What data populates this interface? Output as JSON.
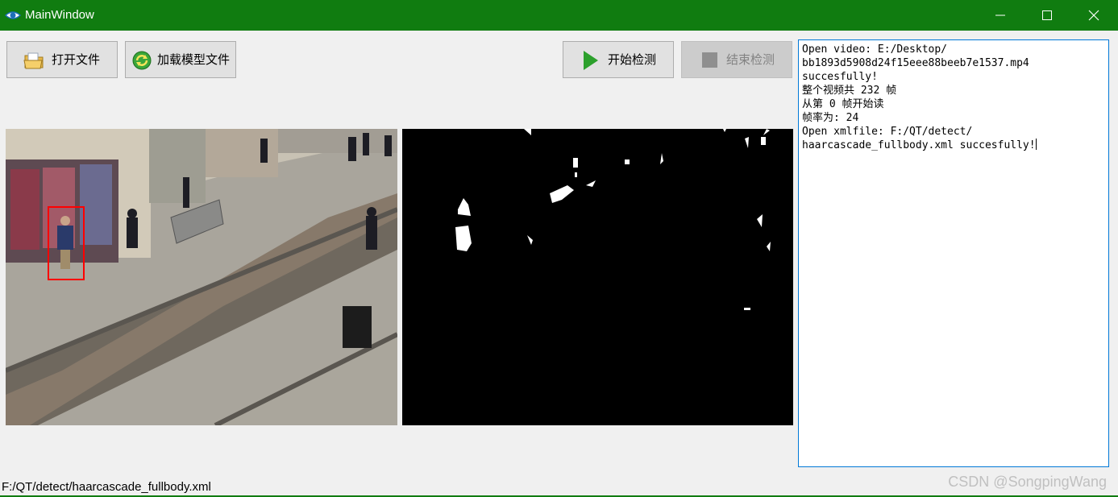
{
  "window": {
    "title": "MainWindow",
    "accent_color": "#107c10",
    "icon": "eye-icon"
  },
  "toolbar": {
    "open_file": {
      "label": "打开文件",
      "icon": "folder-icon"
    },
    "load_model": {
      "label": "加载模型文件",
      "icon": "refresh-icon"
    },
    "start_detect": {
      "label": "开始检测",
      "icon": "play-icon"
    },
    "stop_detect": {
      "label": "结束检测",
      "icon": "stop-icon",
      "enabled": false
    }
  },
  "log": {
    "lines": [
      "Open video: E:/Desktop/",
      "bb1893d5908d24f15eee88beeb7e1537.mp4",
      "succesfully!",
      "整个视频共 232 帧",
      "从第 0 帧开始读",
      "帧率为: 24",
      "Open xmlfile: F:/QT/detect/",
      "haarcascade_fullbody.xml succesfully!"
    ]
  },
  "status": {
    "text": "F:/QT/detect/haarcascade_fullbody.xml"
  },
  "watermark": "CSDN @SongpingWang"
}
